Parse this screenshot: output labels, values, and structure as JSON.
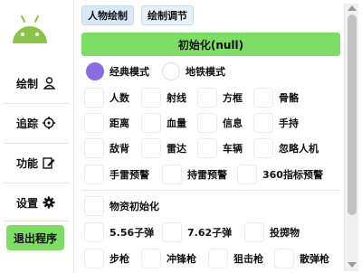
{
  "sidebar": {
    "items": [
      {
        "label": "绘制",
        "icon": "person-icon"
      },
      {
        "label": "追踪",
        "icon": "crosshair-icon"
      },
      {
        "label": "功能",
        "icon": "edit-icon"
      },
      {
        "label": "设置",
        "icon": "gear-icon"
      }
    ],
    "exit_label": "退出程序"
  },
  "tabs": [
    {
      "label": "人物绘制",
      "active": true
    },
    {
      "label": "绘制调节",
      "active": false
    }
  ],
  "init_button": "初始化(null)",
  "modes": [
    {
      "label": "经典模式",
      "selected": true
    },
    {
      "label": "地铁模式",
      "selected": false
    }
  ],
  "option_rows": [
    [
      "人数",
      "射线",
      "方框",
      "骨骼"
    ],
    [
      "距离",
      "血量",
      "信息",
      "手持"
    ],
    [
      "敌背",
      "雷达",
      "车辆",
      "忽略人机"
    ],
    [
      "手雷预警",
      "持雷预警",
      "360指标预警"
    ]
  ],
  "items_section": {
    "init_label": "物资初始化",
    "rows": [
      [
        "5.56子弹",
        "7.62子弹",
        "投掷物"
      ],
      [
        "步枪",
        "冲锋枪",
        "狙击枪",
        "散弹枪"
      ]
    ]
  },
  "colors": {
    "accent_green": "#7ddd66",
    "radio_selected": "#8a6be0",
    "android_green": "#8bc34a"
  }
}
